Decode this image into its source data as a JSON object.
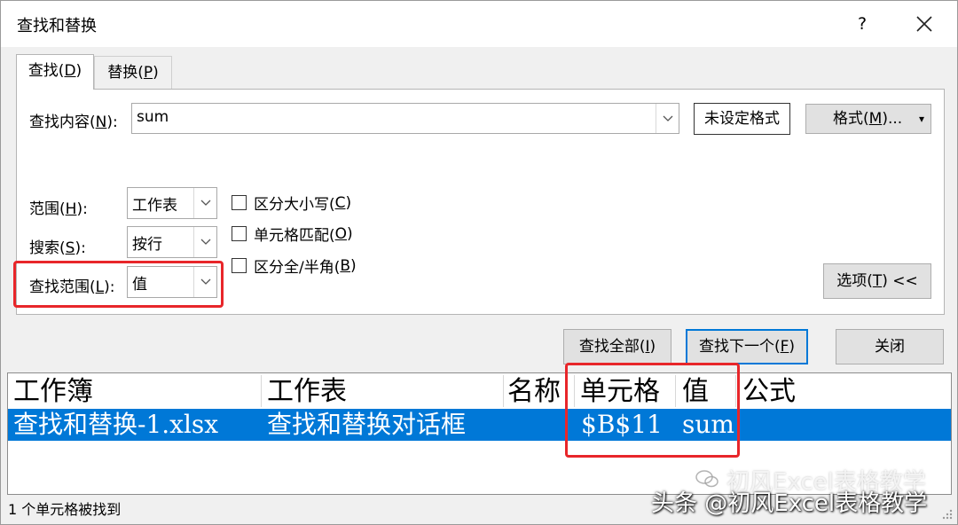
{
  "window": {
    "title": "查找和替换",
    "help": "?"
  },
  "tabs": [
    {
      "label": "查找(",
      "mnemonic": "D",
      "tail": ")"
    },
    {
      "label": "替换(",
      "mnemonic": "P",
      "tail": ")"
    }
  ],
  "find_what": {
    "label": "查找内容(",
    "mnemonic": "N",
    "tail": "):",
    "value": "sum"
  },
  "format_status_label": "未设定格式",
  "format_button": {
    "label": "格式(",
    "mnemonic": "M",
    "tail": ")...",
    "arrow": "▾"
  },
  "within": {
    "label": "范围(",
    "mnemonic": "H",
    "tail": "):",
    "value": "工作表"
  },
  "search": {
    "label": "搜索(",
    "mnemonic": "S",
    "tail": "):",
    "value": "按行"
  },
  "look_in": {
    "label": "查找范围(",
    "mnemonic": "L",
    "tail": "):",
    "value": "值"
  },
  "options": [
    {
      "label": "区分大小写(",
      "mnemonic": "C",
      "tail": ")"
    },
    {
      "label": "单元格匹配(",
      "mnemonic": "O",
      "tail": ")"
    },
    {
      "label": "区分全/半角(",
      "mnemonic": "B",
      "tail": ")"
    }
  ],
  "options_button": {
    "label": "选项(",
    "mnemonic": "T",
    "tail": ") <<"
  },
  "find_all_button": {
    "label": "查找全部(",
    "mnemonic": "I",
    "tail": ")"
  },
  "find_next_button": {
    "label": "查找下一个(",
    "mnemonic": "F",
    "tail": ")"
  },
  "close_button": {
    "label": "关闭"
  },
  "results": {
    "columns": [
      "工作簿",
      "工作表",
      "名称",
      "单元格",
      "值",
      "公式"
    ],
    "rows": [
      {
        "workbook": "查找和替换-1.xlsx",
        "sheet": "查找和替换对话框",
        "name": "",
        "cell": "$B$11",
        "value": "sum",
        "formula": ""
      }
    ]
  },
  "status_text": "1 个单元格被找到",
  "watermark": "初风Excel表格教学",
  "credit": "头条 @初风Excel表格教学",
  "colors": {
    "selection": "#0078d7",
    "highlight_red": "#e8262a",
    "focus_blue": "#0078d7"
  }
}
